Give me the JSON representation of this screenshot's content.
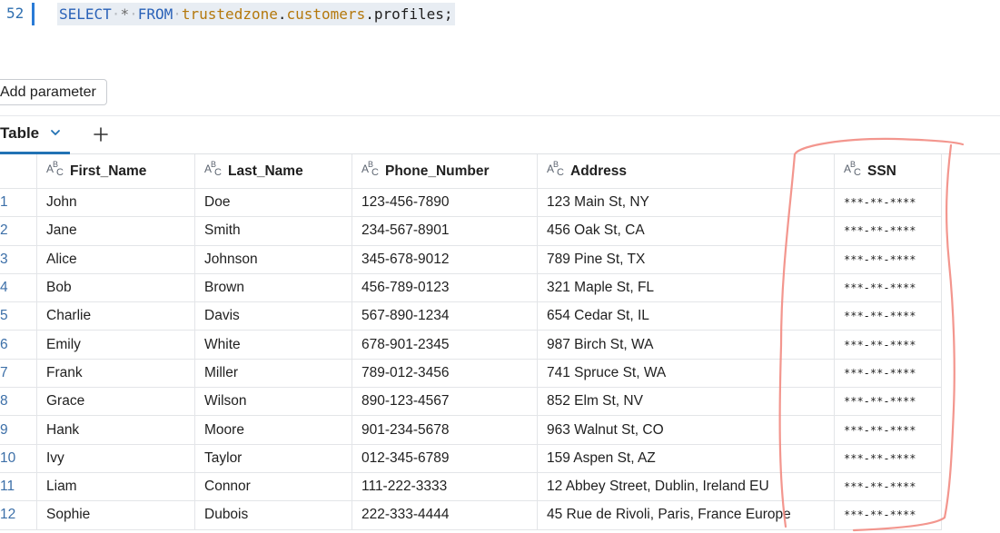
{
  "editor": {
    "line_number": "52",
    "code": {
      "kw_select": "SELECT",
      "star": "*",
      "kw_from": "FROM",
      "ns_catalog": "trustedzone",
      "dot1": ".",
      "ns_schema": "customers",
      "dot2": ".",
      "table": "profiles;"
    }
  },
  "toolbar": {
    "add_parameter_label": "Add parameter"
  },
  "tabs": {
    "active_label": "Table"
  },
  "table": {
    "columns": [
      "First_Name",
      "Last_Name",
      "Phone_Number",
      "Address",
      "SSN"
    ],
    "rows": [
      {
        "idx": "1",
        "first": "John",
        "last": "Doe",
        "phone": "123-456-7890",
        "address": "123 Main St, NY",
        "ssn": "***-**-****"
      },
      {
        "idx": "2",
        "first": "Jane",
        "last": "Smith",
        "phone": "234-567-8901",
        "address": "456 Oak St, CA",
        "ssn": "***-**-****"
      },
      {
        "idx": "3",
        "first": "Alice",
        "last": "Johnson",
        "phone": "345-678-9012",
        "address": "789 Pine St, TX",
        "ssn": "***-**-****"
      },
      {
        "idx": "4",
        "first": "Bob",
        "last": "Brown",
        "phone": "456-789-0123",
        "address": "321 Maple St, FL",
        "ssn": "***-**-****"
      },
      {
        "idx": "5",
        "first": "Charlie",
        "last": "Davis",
        "phone": "567-890-1234",
        "address": "654 Cedar St, IL",
        "ssn": "***-**-****"
      },
      {
        "idx": "6",
        "first": "Emily",
        "last": "White",
        "phone": "678-901-2345",
        "address": "987 Birch St, WA",
        "ssn": "***-**-****"
      },
      {
        "idx": "7",
        "first": "Frank",
        "last": "Miller",
        "phone": "789-012-3456",
        "address": "741 Spruce St, WA",
        "ssn": "***-**-****"
      },
      {
        "idx": "8",
        "first": "Grace",
        "last": "Wilson",
        "phone": "890-123-4567",
        "address": "852 Elm St, NV",
        "ssn": "***-**-****"
      },
      {
        "idx": "9",
        "first": "Hank",
        "last": "Moore",
        "phone": "901-234-5678",
        "address": "963 Walnut St, CO",
        "ssn": "***-**-****"
      },
      {
        "idx": "10",
        "first": "Ivy",
        "last": "Taylor",
        "phone": "012-345-6789",
        "address": "159 Aspen St, AZ",
        "ssn": "***-**-****"
      },
      {
        "idx": "11",
        "first": "Liam",
        "last": "Connor",
        "phone": "111-222-3333",
        "address": "12 Abbey Street, Dublin, Ireland EU",
        "ssn": "***-**-****"
      },
      {
        "idx": "12",
        "first": "Sophie",
        "last": "Dubois",
        "phone": "222-333-4444",
        "address": "45 Rue de Rivoli, Paris, France Europe",
        "ssn": "***-**-****"
      }
    ]
  },
  "icons": {
    "column_type": "string-type-icon",
    "tab_dropdown": "chevron-down-icon",
    "add_tab": "plus-icon"
  },
  "colors": {
    "accent": "#2272b4",
    "annotation": "#f28b82",
    "keyword": "#2a62b8",
    "namespace": "#b4780c"
  }
}
